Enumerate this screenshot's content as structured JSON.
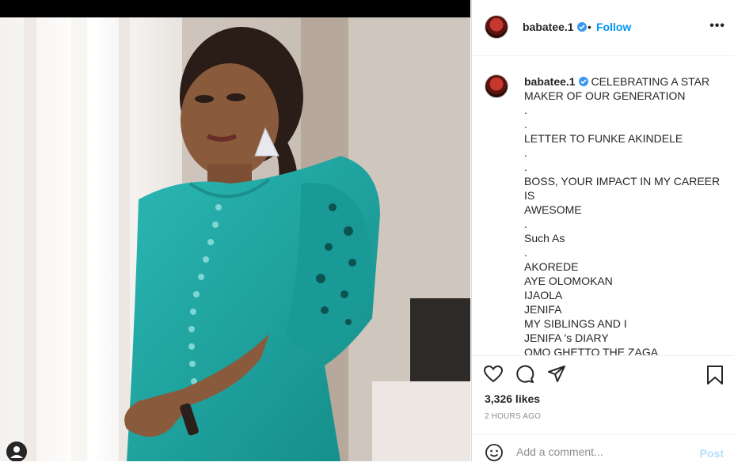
{
  "post": {
    "username": "babatee.1",
    "follow_label": "Follow",
    "dot": "•",
    "more": "•••"
  },
  "caption": {
    "username": "babatee.1",
    "lines": [
      "CELEBRATING A STAR",
      "MAKER OF OUR GENERATION",
      ".",
      ".",
      "LETTER TO FUNKE AKINDELE",
      ".",
      ".",
      "BOSS, YOUR IMPACT IN MY CAREER IS",
      "AWESOME",
      ".",
      "Such As",
      ".",
      "AKOREDE",
      "AYE OLOMOKAN",
      "IJAOLA",
      "JENIFA",
      "MY SIBLINGS AND I",
      "JENIFA 's DIARY",
      "OMO GHETTO THE ZAGA"
    ]
  },
  "stats": {
    "likes": "3,326 likes",
    "time": "2 HOURS AGO"
  },
  "comment": {
    "placeholder": "Add a comment...",
    "post_label": "Post"
  },
  "icons": {
    "like": "heart-icon",
    "comment": "comment-bubble-icon",
    "share": "paper-plane-icon",
    "save": "bookmark-icon",
    "emoji": "emoji-icon",
    "photo_tag": "user-tag-icon"
  },
  "colors": {
    "accent": "#0095f6",
    "verified": "#3897f0",
    "dress": "#1fa3a0"
  }
}
